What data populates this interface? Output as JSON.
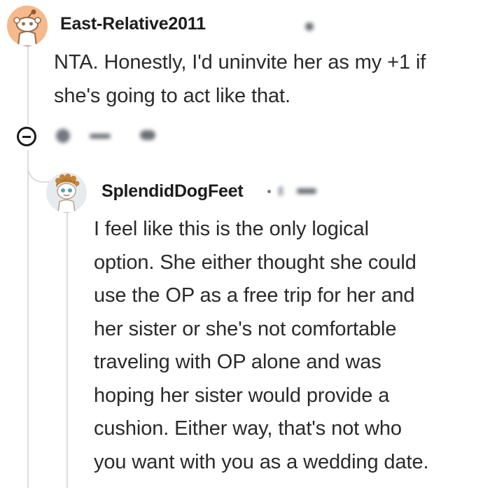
{
  "comments": [
    {
      "username": "East-Relative2011",
      "avatar": "snoo-avatar-icon",
      "body": "NTA. Honestly, I'd uninvite her as my +1 if\nshe's going to act like that."
    },
    {
      "username": "SplendidDogFeet",
      "avatar": "curly-hair-avatar-icon",
      "body": "I feel like this is the only logical\noption. She either thought she could\nuse the OP as a free trip for her and\nher sister or she's not comfortable\ntraveling with OP alone and was\nhoping her sister would provide a\ncushion. Either way, that's not who\nyou want with you as a wedding date."
    }
  ],
  "icons": {
    "collapse": "collapse-minus-icon",
    "award": "award-icon",
    "upvote": "upvote-icon"
  },
  "colors": {
    "thread_line": "#dcdcdc",
    "snoo_bg": "#f5b98b",
    "text": "#1c1c1c"
  }
}
